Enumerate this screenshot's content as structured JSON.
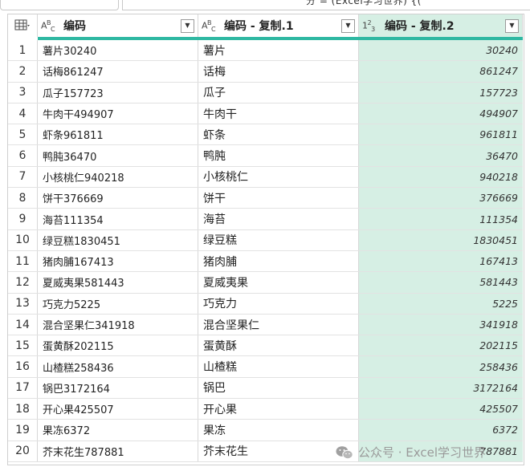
{
  "formula_bar": {
    "text": "分 = (Excel学习世界) {("
  },
  "columns": [
    {
      "type_icon": "ABC",
      "label": "编码"
    },
    {
      "type_icon": "ABC",
      "label": "编码 - 复制.1"
    },
    {
      "type_icon": "123",
      "label": "编码 - 复制.2"
    }
  ],
  "rows": [
    {
      "idx": "1",
      "a": "薯片30240",
      "b": "薯片",
      "c": "30240"
    },
    {
      "idx": "2",
      "a": "话梅861247",
      "b": "话梅",
      "c": "861247"
    },
    {
      "idx": "3",
      "a": "瓜子157723",
      "b": "瓜子",
      "c": "157723"
    },
    {
      "idx": "4",
      "a": "牛肉干494907",
      "b": "牛肉干",
      "c": "494907"
    },
    {
      "idx": "5",
      "a": "虾条961811",
      "b": "虾条",
      "c": "961811"
    },
    {
      "idx": "6",
      "a": "鸭肫36470",
      "b": "鸭肫",
      "c": "36470"
    },
    {
      "idx": "7",
      "a": "小核桃仁940218",
      "b": "小核桃仁",
      "c": "940218"
    },
    {
      "idx": "8",
      "a": "饼干376669",
      "b": "饼干",
      "c": "376669"
    },
    {
      "idx": "9",
      "a": "海苔111354",
      "b": "海苔",
      "c": "111354"
    },
    {
      "idx": "10",
      "a": "绿豆糕1830451",
      "b": "绿豆糕",
      "c": "1830451"
    },
    {
      "idx": "11",
      "a": "猪肉脯167413",
      "b": "猪肉脯",
      "c": "167413"
    },
    {
      "idx": "12",
      "a": "夏威夷果581443",
      "b": "夏威夷果",
      "c": "581443"
    },
    {
      "idx": "13",
      "a": "巧克力5225",
      "b": "巧克力",
      "c": "5225"
    },
    {
      "idx": "14",
      "a": "混合坚果仁341918",
      "b": "混合坚果仁",
      "c": "341918"
    },
    {
      "idx": "15",
      "a": "蛋黄酥202115",
      "b": "蛋黄酥",
      "c": "202115"
    },
    {
      "idx": "16",
      "a": "山楂糕258436",
      "b": "山楂糕",
      "c": "258436"
    },
    {
      "idx": "17",
      "a": "锅巴3172164",
      "b": "锅巴",
      "c": "3172164"
    },
    {
      "idx": "18",
      "a": "开心果425507",
      "b": "开心果",
      "c": "425507"
    },
    {
      "idx": "19",
      "a": "果冻6372",
      "b": "果冻",
      "c": "6372"
    },
    {
      "idx": "20",
      "a": "芥末花生787881",
      "b": "芥末花生",
      "c": "787881"
    }
  ],
  "watermark": {
    "text": "公众号 · Excel学习世界",
    "icon": "wechat-icon"
  },
  "colors": {
    "accent": "#2fb8a2",
    "selected_column": "#d6efe4",
    "border": "#d8d8d8"
  }
}
